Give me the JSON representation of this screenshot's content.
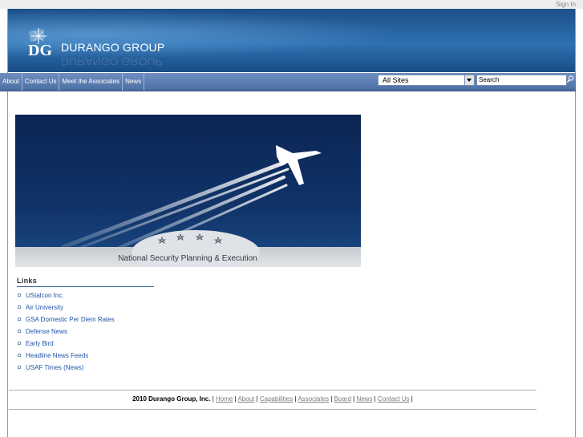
{
  "header": {
    "sign_in": "Sign In",
    "logo_mark": "DG",
    "logo_text": "DURANGO GROUP"
  },
  "nav": {
    "tabs": [
      "About",
      "Contact Us",
      "Meet the Associates",
      "News"
    ]
  },
  "search": {
    "scope_value": "All Sites",
    "placeholder": "Search"
  },
  "banner": {
    "caption": "National Security Planning & Execution"
  },
  "links": {
    "title": "Links",
    "items": [
      "UStalcon Inc.",
      "Air University",
      "GSA Domestic Per Diem Rates",
      "Defense News",
      "Early Bird",
      "Headline News Feeds",
      "USAF Times (News)"
    ]
  },
  "footer": {
    "copyright": "2010 Durango Group, Inc.",
    "links": [
      "Home",
      "About",
      "Capabilities",
      "Associates",
      "Board",
      "News",
      "Contact Us"
    ]
  },
  "colors": {
    "header_blue": "#2d71b1",
    "nav_blue": "#4a6ea4",
    "link_blue": "#1f54a6",
    "banner_navy": "#0d2a5a"
  }
}
